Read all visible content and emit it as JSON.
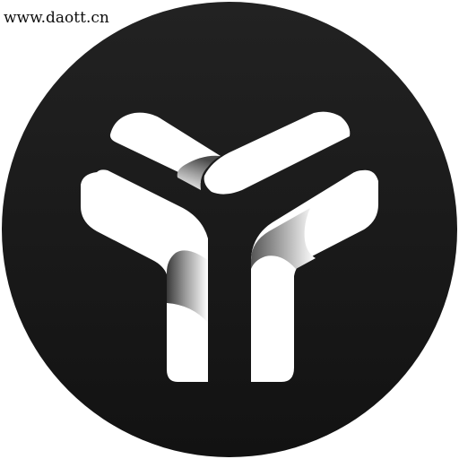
{
  "watermark": {
    "text": "www.daott.cn"
  },
  "logo": {
    "icon": "three-blade-y-logo-icon",
    "colors": {
      "disc": "#141414",
      "disc_top": "#1e1e1e",
      "blade": "#ffffff",
      "fold_shadow": "#777777"
    }
  }
}
